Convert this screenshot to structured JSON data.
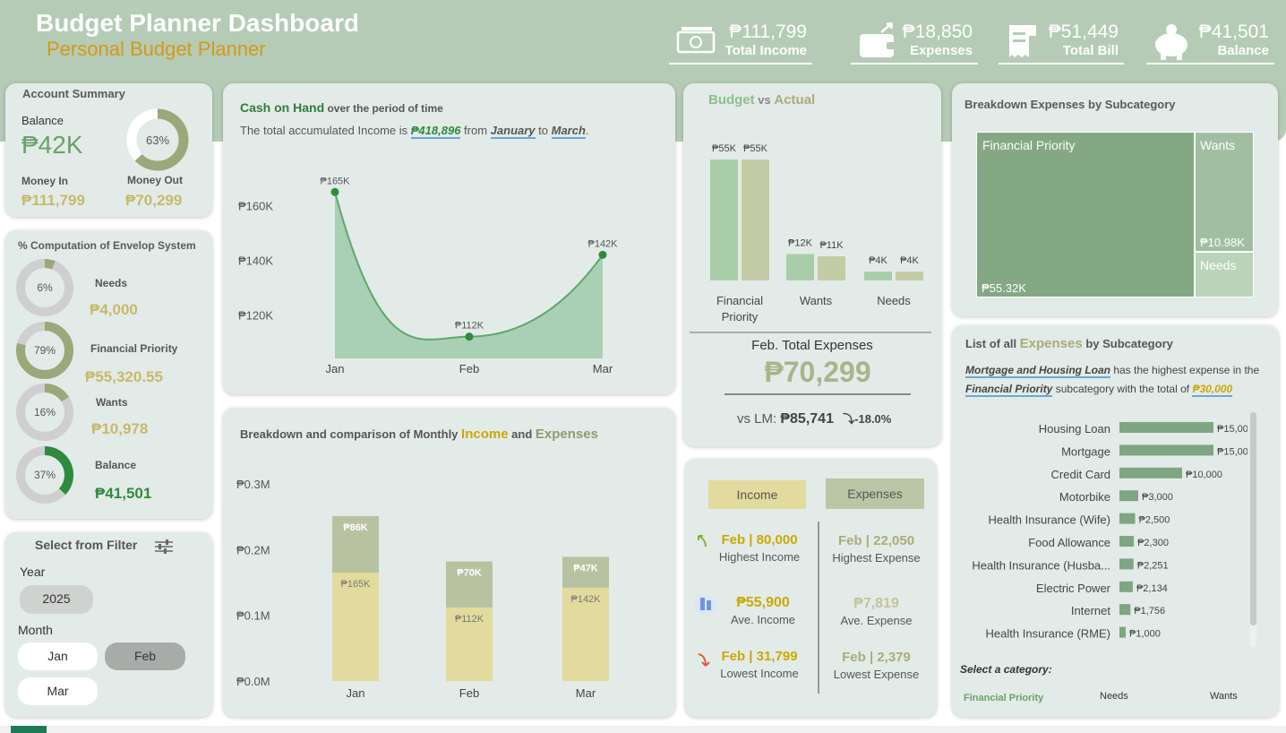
{
  "header": {
    "title": "Budget Planner Dashboard",
    "subtitle": "Personal Budget Planner",
    "kpis": [
      {
        "value": "₱111,799",
        "label": "Total Income",
        "icon": "money-icon"
      },
      {
        "value": "₱18,850",
        "label": "Expenses",
        "icon": "wallet-icon"
      },
      {
        "value": "₱51,449",
        "label": "Total Bill",
        "icon": "receipt-icon"
      },
      {
        "value": "₱41,501",
        "label": "Balance",
        "icon": "piggy-bank-icon"
      }
    ]
  },
  "account_summary": {
    "title": "Account Summary",
    "balance_label": "Balance",
    "balance_value": "₱42K",
    "donut_label": "63%",
    "donut_fraction": 0.63,
    "money_in_label": "Money In",
    "money_in_value": "₱111,799",
    "money_out_label": "Money Out",
    "money_out_value": "₱70,299"
  },
  "envelope": {
    "title": "% Computation of Envelop System",
    "items": [
      {
        "pct": "6%",
        "fraction": 0.06,
        "label": "Needs",
        "value": "₱4,000",
        "color": "#9aa87a"
      },
      {
        "pct": "79%",
        "fraction": 0.79,
        "label": "Financial Priority",
        "value": "₱55,320.55",
        "color": "#9aa87a"
      },
      {
        "pct": "16%",
        "fraction": 0.16,
        "label": "Wants",
        "value": "₱10,978",
        "color": "#9aa87a"
      },
      {
        "pct": "37%",
        "fraction": 0.37,
        "label": "Balance",
        "value": "₱41,501",
        "color": "#2e8b3e"
      }
    ]
  },
  "filter": {
    "title": "Select from Filter",
    "year_label": "Year",
    "year_value": "2025",
    "month_label": "Month",
    "months": [
      {
        "label": "Jan",
        "selected": false
      },
      {
        "label": "Feb",
        "selected": true
      },
      {
        "label": "Mar",
        "selected": false
      }
    ]
  },
  "cash_on_hand": {
    "title_bold": "Cash on Hand",
    "title_rest": " over the period of time",
    "desc_prefix": "The total accumulated Income is ",
    "desc_total": "₱418,896",
    "desc_from": " from ",
    "desc_start": "January",
    "desc_to": " to ",
    "desc_end": "March",
    "desc_dot": "."
  },
  "budget_actual": {
    "title_a": "Budget",
    "title_vs": " vs ",
    "title_b": "Actual",
    "feb_label": "Feb. Total Expenses",
    "feb_value": "₱70,299",
    "vs_label": "vs LM:",
    "vs_value": "₱85,741",
    "vs_change": "-18.0%"
  },
  "treemap": {
    "title": "Breakdown Expenses by Subcategory",
    "cells": [
      {
        "label": "Financial Priority",
        "value": "₱55.32K"
      },
      {
        "label": "Wants",
        "value": "₱10.98K"
      },
      {
        "label": "Needs",
        "value": ""
      }
    ]
  },
  "expense_list": {
    "title_a": "List of all ",
    "title_b": "Expenses",
    "title_c": " by Subcategory",
    "desc_item": "Mortgage and Housing Loan",
    "desc_mid": " has the highest expense in the",
    "desc_cat": "Financial Priority",
    "desc_mid2": " subcategory with the total of ",
    "desc_total": "₱30,000",
    "select_label": "Select a category:",
    "categories": [
      {
        "label": "Financial Priority",
        "active": true
      },
      {
        "label": "Needs",
        "active": false
      },
      {
        "label": "Wants",
        "active": false
      }
    ]
  },
  "income_expense_stats": {
    "income_header": "Income",
    "expenses_header": "Expenses",
    "rows": [
      {
        "income_value": "Feb | 80,000",
        "income_label": "Highest Income",
        "expense_value": "Feb | 22,050",
        "expense_label": "Highest Expense",
        "icon": "arrow-up-icon"
      },
      {
        "income_value": "₱55,900",
        "income_label": "Ave. Income",
        "expense_value": "₱7,819",
        "expense_label": "Ave. Expense",
        "icon": "building-icon"
      },
      {
        "income_value": "Feb | 31,799",
        "income_label": "Lowest Income",
        "expense_value": "Feb | 2,379",
        "expense_label": "Lowest Expense",
        "icon": "arrow-down-icon"
      }
    ]
  },
  "monthly": {
    "title_a": "Breakdown and comparison of Monthly ",
    "title_b": "Income",
    "title_c": " and ",
    "title_d": "Expenses"
  },
  "chart_data": [
    {
      "id": "cash_on_hand",
      "type": "area",
      "categories": [
        "Jan",
        "Feb",
        "Mar"
      ],
      "values": [
        165,
        112,
        142
      ],
      "data_labels": [
        "₱165K",
        "₱112K",
        "₱142K"
      ],
      "y_ticks": [
        "₱120K",
        "₱140K",
        "₱160K"
      ],
      "y_tick_values": [
        120,
        140,
        160
      ],
      "ylim": [
        104,
        172
      ],
      "color": "#5fa76c",
      "fill": "#a9cfb5"
    },
    {
      "id": "budget_vs_actual",
      "type": "bar",
      "categories": [
        "Financial Priority",
        "Wants",
        "Needs"
      ],
      "category_lines": [
        [
          "Financial",
          "Priority"
        ],
        [
          "Wants"
        ],
        [
          "Needs"
        ]
      ],
      "series": [
        {
          "name": "Budget",
          "values": [
            55,
            12,
            4
          ],
          "labels": [
            "₱55K",
            "₱12K",
            "₱4K"
          ],
          "color": "#aacda9"
        },
        {
          "name": "Actual",
          "values": [
            55,
            11,
            4
          ],
          "labels": [
            "₱55K",
            "₱11K",
            "₱4K"
          ],
          "color": "#c4cca5"
        }
      ],
      "ylim": [
        0,
        60
      ]
    },
    {
      "id": "monthly_income_expenses",
      "type": "bar",
      "stacked": true,
      "categories": [
        "Jan",
        "Feb",
        "Mar"
      ],
      "series": [
        {
          "name": "Income",
          "values": [
            165,
            112,
            142
          ],
          "labels": [
            "₱165K",
            "₱112K",
            "₱142K"
          ],
          "color": "#e2db9d"
        },
        {
          "name": "Expenses",
          "values": [
            86,
            70,
            47
          ],
          "labels": [
            "₱86K",
            "₱70K",
            "₱47K"
          ],
          "color": "#b8c2a1"
        }
      ],
      "y_ticks": [
        "₱0.0M",
        "₱0.1M",
        "₱0.2M",
        "₱0.3M"
      ],
      "y_tick_values": [
        0,
        100,
        200,
        300
      ],
      "ylim": [
        0,
        300
      ]
    },
    {
      "id": "expenses_by_subcategory",
      "type": "bar",
      "orientation": "horizontal",
      "categories": [
        "Housing Loan",
        "Mortgage",
        "Credit Card",
        "Motorbike",
        "Health Insurance (Wife)",
        "Food Allowance",
        "Health Insurance (Husba...",
        "Electric Power",
        "Internet",
        "Health Insurance (RME)"
      ],
      "values": [
        15000,
        15000,
        10000,
        3000,
        2500,
        2300,
        2251,
        2134,
        1756,
        1000
      ],
      "labels": [
        "₱15,000",
        "₱15,000",
        "₱10,000",
        "₱3,000",
        "₱2,500",
        "₱2,300",
        "₱2,251",
        "₱2,134",
        "₱1,756",
        "₱1,000"
      ],
      "color": "#7fa582",
      "xlim": [
        0,
        15000
      ]
    },
    {
      "id": "subcategory_treemap",
      "type": "treemap",
      "categories": [
        "Financial Priority",
        "Wants",
        "Needs"
      ],
      "values": [
        55.32,
        10.98,
        4.0
      ],
      "colors": [
        "#84a884",
        "#a2bea2",
        "#bad4ba"
      ]
    }
  ]
}
